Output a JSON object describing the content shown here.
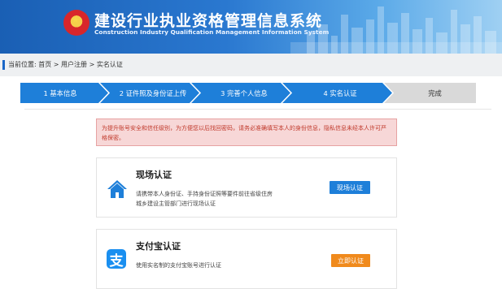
{
  "header": {
    "title_cn": "建设行业执业资格管理信息系统",
    "title_en": "Construction Industry Qualification Management Information System",
    "emblem_icon": "national-emblem-icon",
    "colors": {
      "primary": "#1a5fb4",
      "light": "#9fd0f3"
    }
  },
  "breadcrumb": {
    "label": "当前位置:",
    "items": [
      "首页",
      "用户注册",
      "实名认证"
    ],
    "separator": ">"
  },
  "steps": [
    {
      "label": "1 基本信息",
      "state": "done"
    },
    {
      "label": "2 证件照及身份证上传",
      "state": "done"
    },
    {
      "label": "3 完善个人信息",
      "state": "done"
    },
    {
      "label": "4 实名认证",
      "state": "current"
    },
    {
      "label": "完成",
      "state": "pending"
    }
  ],
  "step_colors": {
    "done": "#1e7fd9",
    "current": "#1e7fd9",
    "pending": "#d9d9d9",
    "pending_text": "#333333"
  },
  "alert": {
    "text": "为提升账号安全和信任级别，为方便您以后找回密码，请务必准确填写本人的身份信息，隐私信息未经本人许可严格保密。",
    "bg": "#f7d7d7",
    "color": "#c0392b"
  },
  "cards": [
    {
      "title": "现场认证",
      "desc": "请携带本人身份证、手持身份证照等要件前往省级住房城乡建设主管部门进行现场认证",
      "button": "现场认证",
      "button_color": "#1e7fd9",
      "icon": "home-icon"
    },
    {
      "title": "支付宝认证",
      "desc": "使用实名制的支付宝账号进行认证",
      "button": "立即认证",
      "button_color": "#f08a1c",
      "icon": "alipay-icon"
    }
  ]
}
